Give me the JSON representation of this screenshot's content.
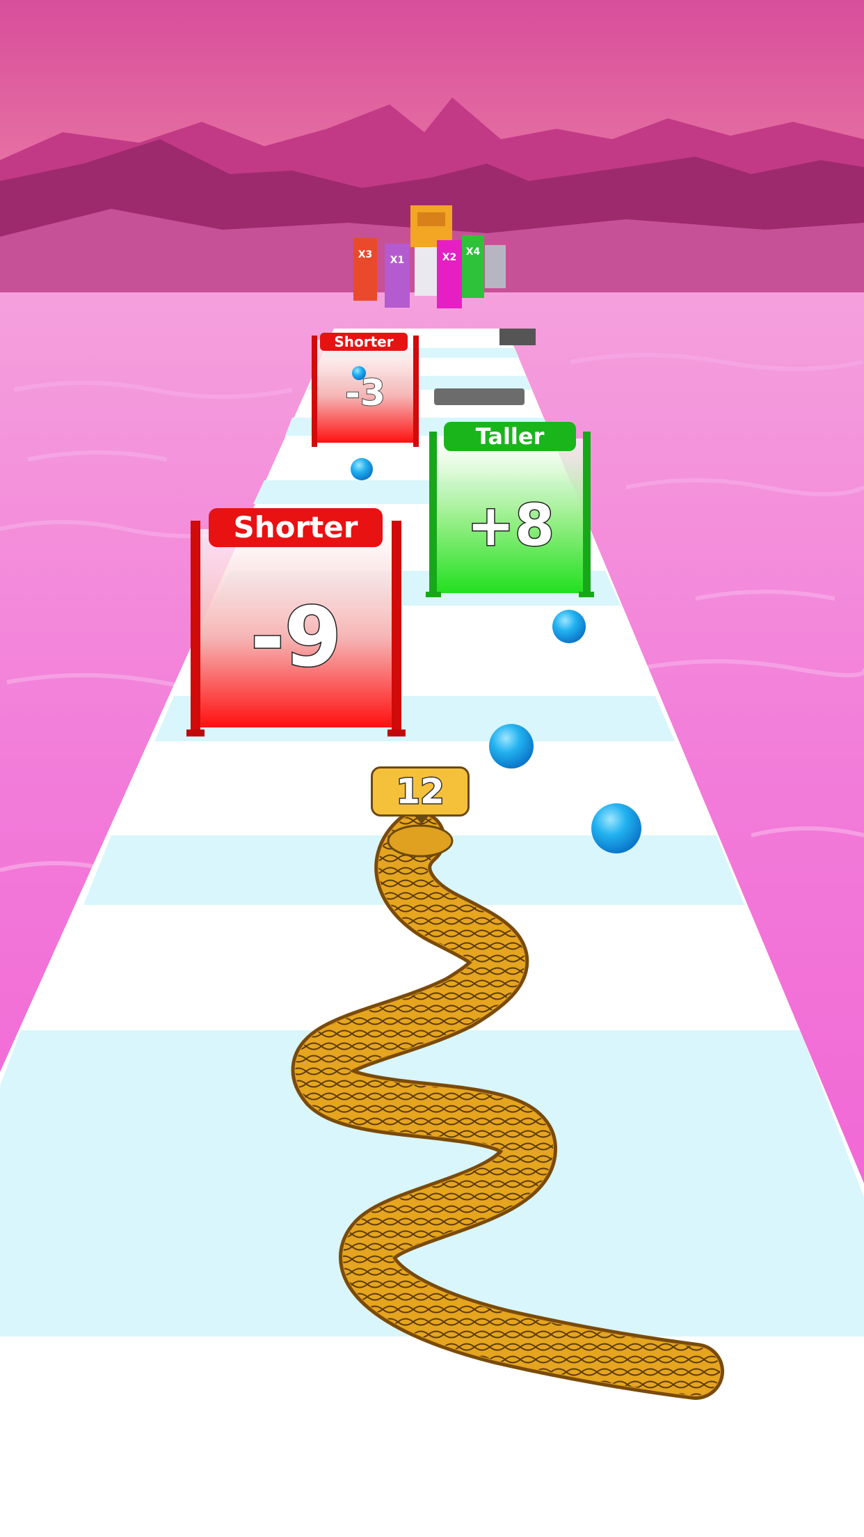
{
  "snake_length": "12",
  "gates": [
    {
      "label": "Shorter",
      "value": "-3",
      "color": "#e81212"
    },
    {
      "label": "Taller",
      "value": "+8",
      "color": "#19b51b"
    },
    {
      "label": "Shorter",
      "value": "-9",
      "color": "#e81212"
    }
  ],
  "multipliers": [
    "X3",
    "X1",
    "X2",
    "X4"
  ],
  "colors": {
    "sky_top": "#d84e9b",
    "mountains": "#b8327f",
    "water": "#f27bd9",
    "track_white": "#ffffff",
    "track_stripe": "#d8f6fb",
    "orb": "#1fa8e8",
    "snake": "#e6a51f",
    "badge": "#f6c13a"
  }
}
